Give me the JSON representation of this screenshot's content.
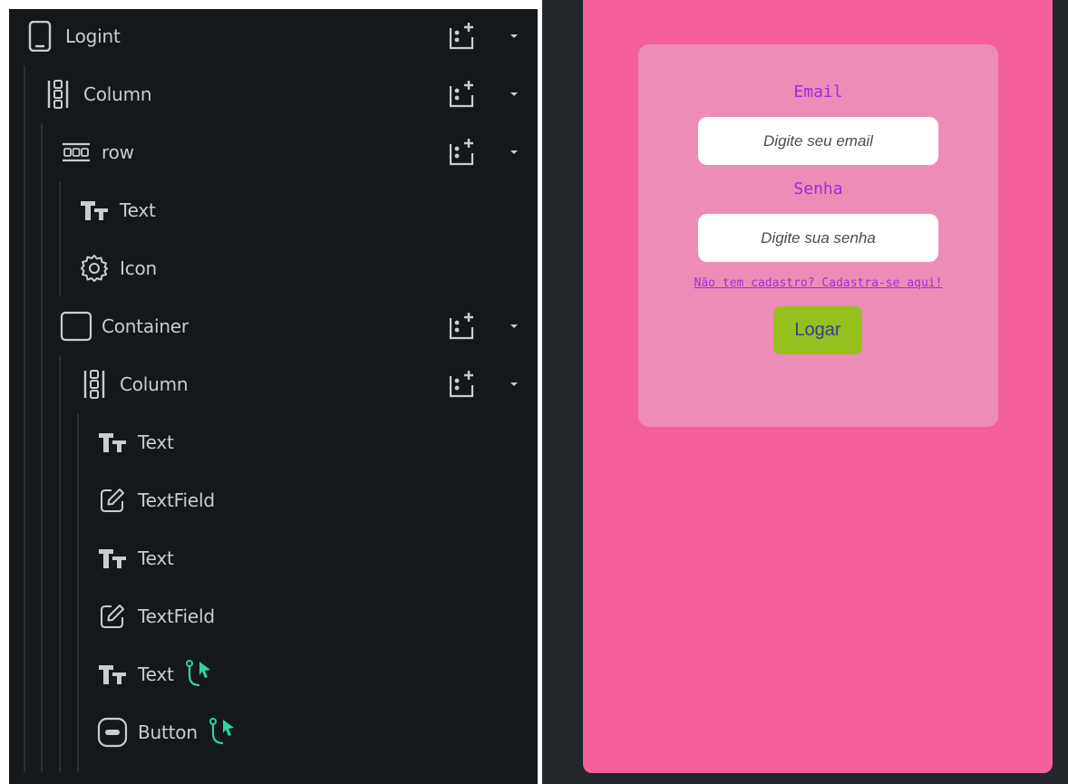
{
  "widget_tree": {
    "nodes": [
      {
        "label": "Logint",
        "icon": "phone-icon"
      },
      {
        "label": "Column",
        "icon": "column-icon"
      },
      {
        "label": "row",
        "icon": "row-icon"
      },
      {
        "label": "Text",
        "icon": "text-icon"
      },
      {
        "label": "Icon",
        "icon": "gear-icon"
      },
      {
        "label": "Container",
        "icon": "container-icon"
      },
      {
        "label": "Column",
        "icon": "column-icon"
      },
      {
        "label": "Text",
        "icon": "text-icon"
      },
      {
        "label": "TextField",
        "icon": "textfield-icon"
      },
      {
        "label": "Text",
        "icon": "text-icon"
      },
      {
        "label": "TextField",
        "icon": "textfield-icon"
      },
      {
        "label": "Text",
        "icon": "text-icon",
        "has_action": true
      },
      {
        "label": "Button",
        "icon": "button-icon",
        "has_action": true
      }
    ],
    "colors": {
      "panel_bg": "#14181b",
      "label": "#c9ccd0",
      "icon": "#c9ccd0",
      "action_accent": "#2fd3a6"
    }
  },
  "preview": {
    "email_label": "Email",
    "email_placeholder": "Digite seu email",
    "password_label": "Senha",
    "password_placeholder": "Digite sua senha",
    "signup_link": "Não tem cadastro? Cadastra-se aqui!",
    "login_button": "Logar",
    "colors": {
      "page_bg": "#f3609c",
      "card_bg": "#ee8cb8",
      "label": "#a02cd8",
      "button_bg": "#95c11e",
      "button_text": "#3b3d8c",
      "canvas_bg": "#23272c"
    }
  }
}
